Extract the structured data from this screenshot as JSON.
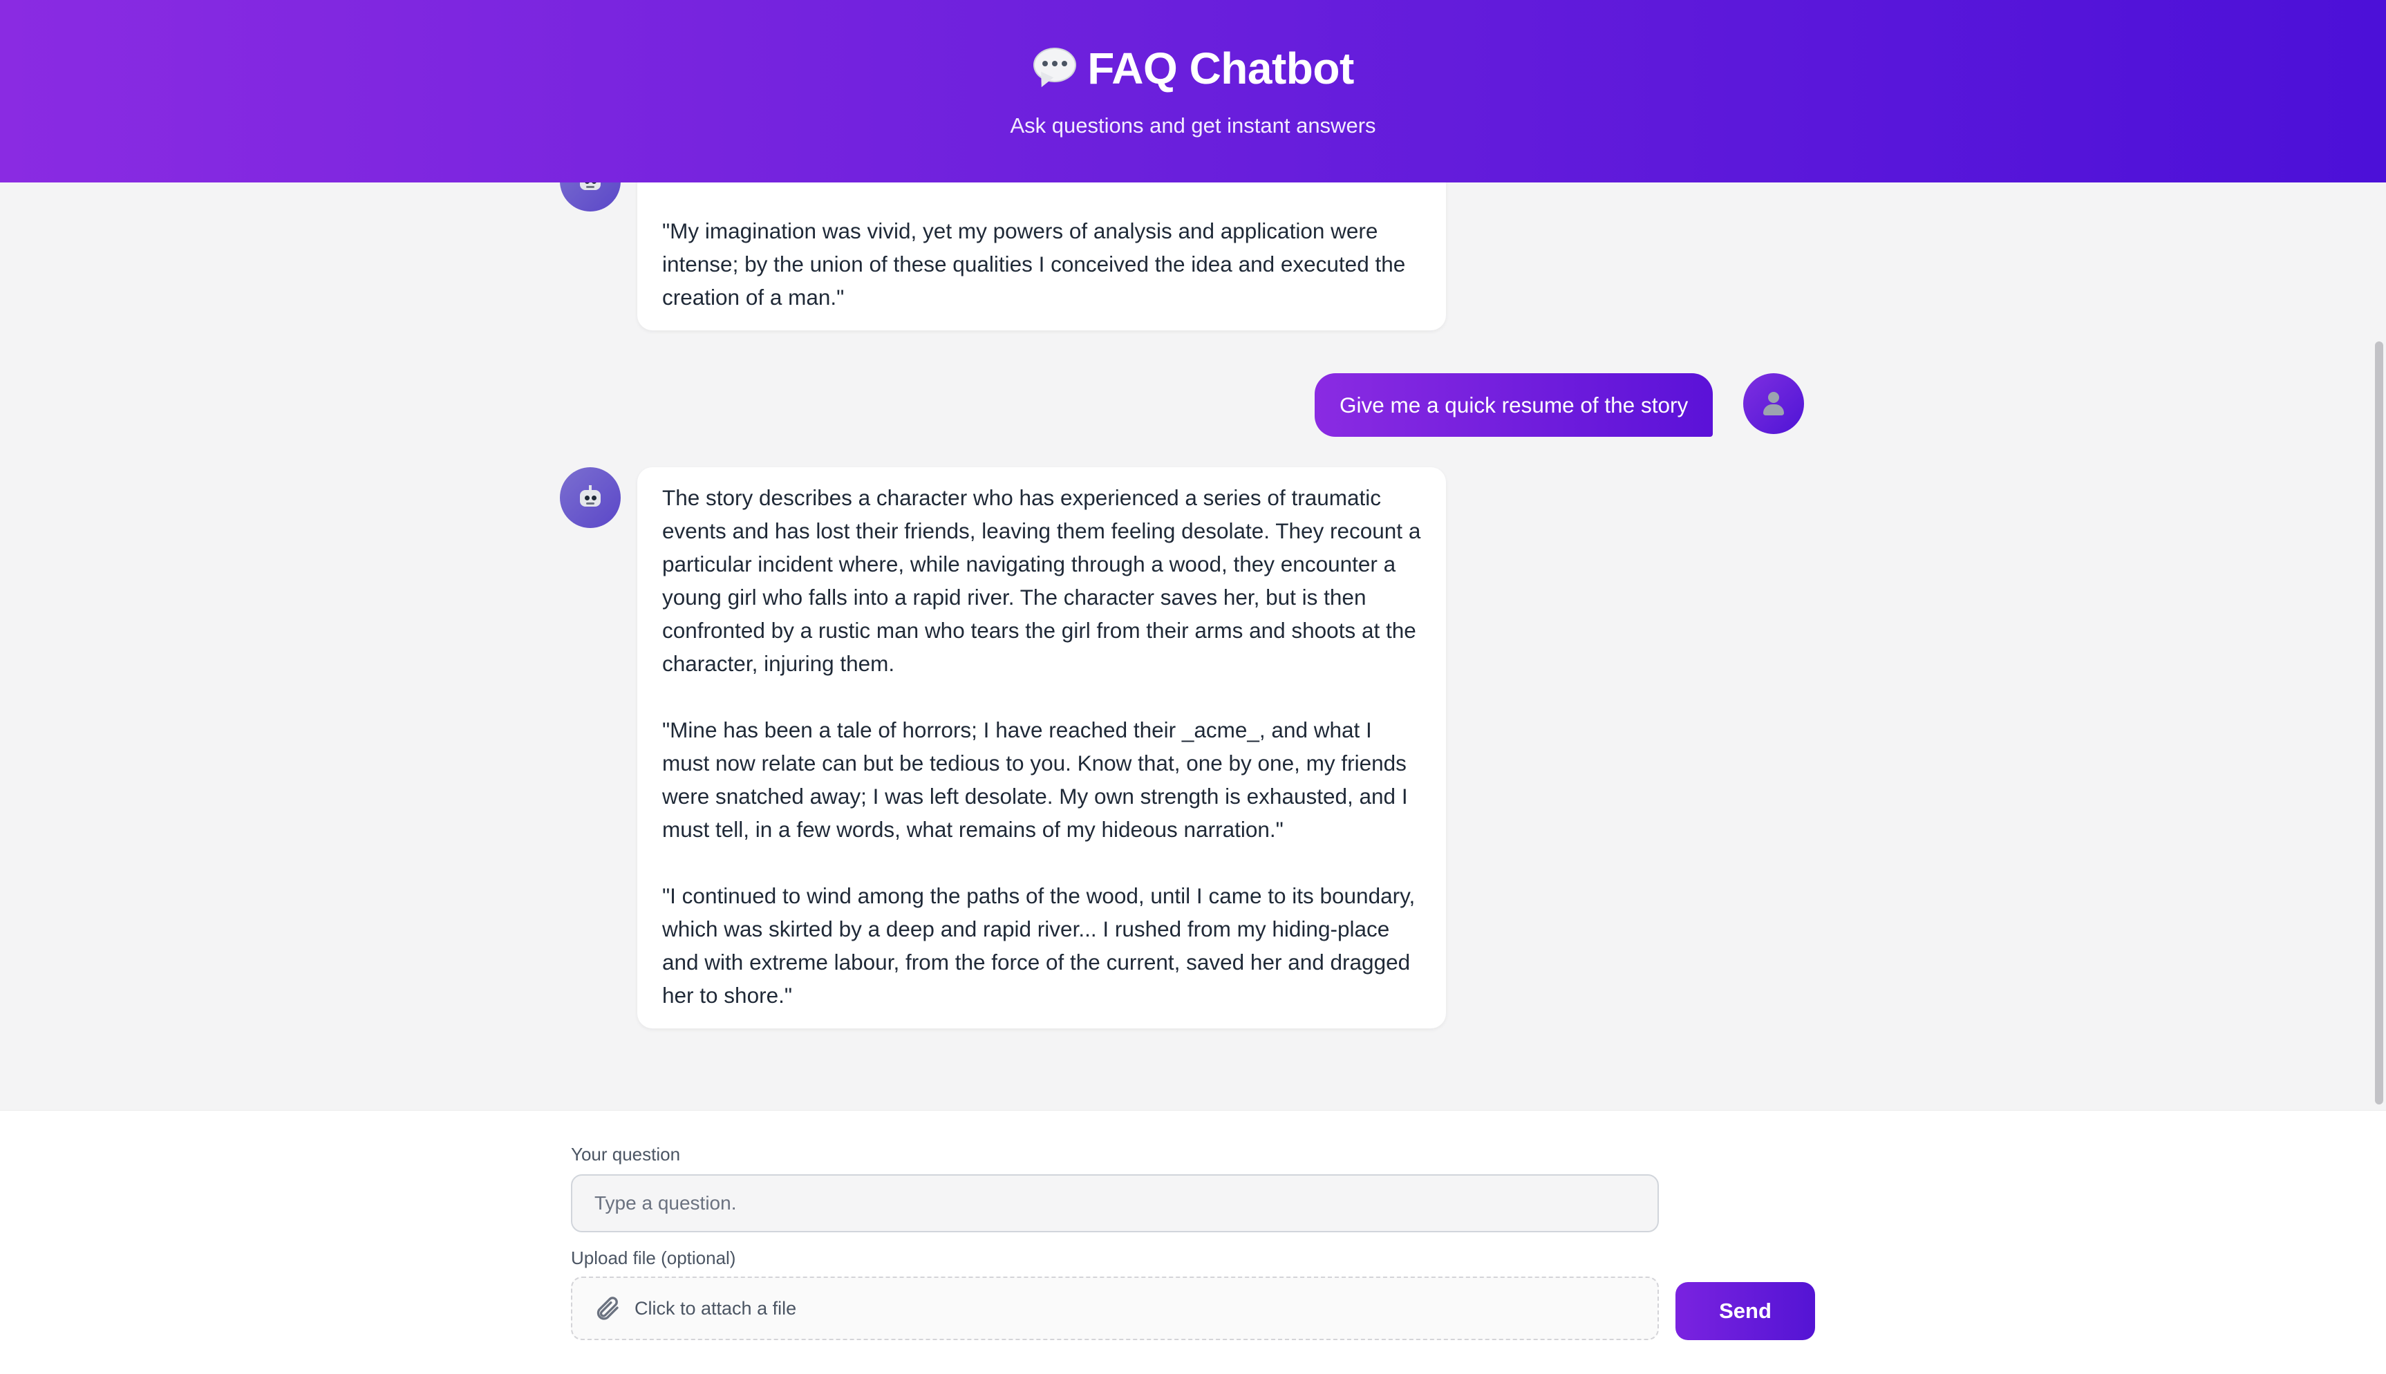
{
  "header": {
    "title": "FAQ Chatbot",
    "subtitle": "Ask questions and get instant answers",
    "icon": "speech-bubble-icon"
  },
  "messages": [
    {
      "role": "bot",
      "avatar_icon": "robot-icon",
      "text": "The text is a snippet from \"Frankenstein,\" written by Mary Shelley.\n\n\"My imagination was vivid, yet my powers of analysis and application were intense; by the union of these qualities I conceived the idea and executed the creation of a man.\""
    },
    {
      "role": "user",
      "avatar_icon": "person-icon",
      "text": "Give me a quick resume of the story"
    },
    {
      "role": "bot",
      "avatar_icon": "robot-icon",
      "text": "The story describes a character who has experienced a series of traumatic events and has lost their friends, leaving them feeling desolate. They recount a particular incident where, while navigating through a wood, they encounter a young girl who falls into a rapid river. The character saves her, but is then confronted by a rustic man who tears the girl from their arms and shoots at the character, injuring them.\n\n\"Mine has been a tale of horrors; I have reached their _acme_, and what I must now relate can but be tedious to you. Know that, one by one, my friends were snatched away; I was left desolate. My own strength is exhausted, and I must tell, in a few words, what remains of my hideous narration.\"\n\n\"I continued to wind among the paths of the wood, until I came to its boundary, which was skirted by a deep and rapid river... I rushed from my hiding-place and with extreme labour, from the force of the current, saved her and dragged her to shore.\""
    }
  ],
  "input": {
    "question_label": "Your question",
    "question_placeholder": "Type a question.",
    "question_value": "",
    "upload_label": "Upload file (optional)",
    "upload_text": "Click to attach a file",
    "upload_icon": "paperclip-icon",
    "send_label": "Send"
  },
  "colors": {
    "accent_start": "#8a2be2",
    "accent_end": "#4c10d8",
    "background": "#f4f4f5"
  }
}
